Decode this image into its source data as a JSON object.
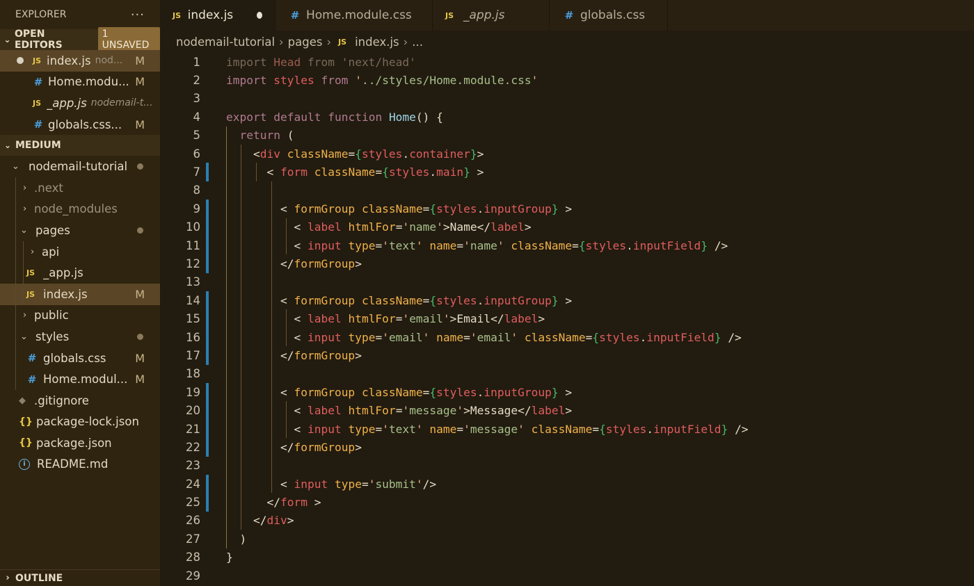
{
  "explorer": {
    "title": "EXPLORER",
    "more": "···",
    "open_editors": {
      "label": "OPEN EDITORS",
      "badge": "1 UNSAVED",
      "items": [
        {
          "icon": "JS",
          "name": "index.js",
          "desc": "nod...",
          "mark": "M"
        },
        {
          "icon": "#",
          "name": "Home.modu...",
          "desc": "",
          "mark": "M"
        },
        {
          "icon": "JS",
          "name": "_app.js",
          "desc": "nodemail-t...",
          "mark": ""
        },
        {
          "icon": "#",
          "name": "globals.css...",
          "desc": "",
          "mark": "M"
        }
      ]
    },
    "workspace": {
      "label": "MEDIUM",
      "tree": {
        "root": "nodemail-tutorial",
        "next": ".next",
        "node_modules": "node_modules",
        "pages": "pages",
        "api": "api",
        "app_js": "_app.js",
        "index_js": "index.js",
        "public": "public",
        "styles": "styles",
        "globals_css": "globals.css",
        "home_css": "Home.modul...",
        "gitignore": ".gitignore",
        "package_lock": "package-lock.json",
        "package_json": "package.json",
        "readme": "README.md",
        "mark_m": "M"
      }
    },
    "outline": "OUTLINE"
  },
  "tabs": [
    {
      "icon": "JS",
      "label": "index.js"
    },
    {
      "icon": "#",
      "label": "Home.module.css"
    },
    {
      "icon": "JS",
      "label": "_app.js"
    },
    {
      "icon": "#",
      "label": "globals.css"
    }
  ],
  "breadcrumb": {
    "folder": "nodemail-tutorial",
    "sub": "pages",
    "icon": "JS",
    "file": "index.js",
    "tail": "..."
  },
  "editor": {
    "line_numbers": [
      "1",
      "2",
      "3",
      "4",
      "5",
      "6",
      "7",
      "8",
      "9",
      "10",
      "11",
      "12",
      "13",
      "14",
      "15",
      "16",
      "17",
      "18",
      "19",
      "20",
      "21",
      "22",
      "23",
      "24",
      "25",
      "26",
      "27",
      "28",
      "29"
    ]
  },
  "colors": {
    "sidebar_bg": "#2f240f",
    "editor_bg": "#221b10",
    "modified_gutter": "#2a7fb3",
    "tag_red": "#e05e5e",
    "attr_orange": "#f0b24a",
    "string_green": "#a7c08a"
  }
}
